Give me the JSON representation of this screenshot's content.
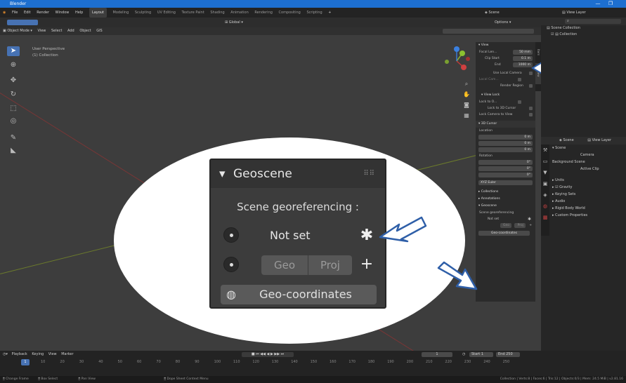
{
  "titlebar": {
    "title": "Blender"
  },
  "menubar": {
    "items": [
      "File",
      "Edit",
      "Render",
      "Window",
      "Help"
    ],
    "workspaces": [
      "Layout",
      "Modeling",
      "Sculpting",
      "UV Editing",
      "Texture Paint",
      "Shading",
      "Animation",
      "Rendering",
      "Compositing",
      "Scripting"
    ],
    "scene_label": "Scene",
    "view_layer_label": "View Layer"
  },
  "viewport": {
    "transform_orientation": "Global",
    "options_label": "Options",
    "mode_label": "Object Mode",
    "header_menus": [
      "View",
      "Select",
      "Add",
      "Object",
      "GIS"
    ],
    "perspective_label": "User Perspective",
    "collection_label": "(1) Collection"
  },
  "npanel": {
    "view_header": "View",
    "focal_length_label": "Focal Len...",
    "focal_length_value": "50 mm",
    "clip_start_label": "Clip Start",
    "clip_start_value": "0.1 m",
    "clip_end_label": "End",
    "clip_end_value": "1000 m",
    "use_local_camera": "Use Local Camera",
    "local_camera": "Local Cam...",
    "render_region": "Render Region",
    "view_lock_header": "View Lock",
    "lock_to_object": "Lock to O...",
    "lock_to_3d_cursor": "Lock to 3D Cursor",
    "lock_camera_to_view": "Lock Camera to View",
    "cursor_header": "3D Cursor",
    "location_label": "Location",
    "loc_x": "0 m",
    "loc_y": "0 m",
    "loc_z": "0 m",
    "rotation_label": "Rotation",
    "rot_x": "0°",
    "rot_y": "0°",
    "rot_z": "0°",
    "rotation_mode": "XYZ Euler",
    "collections_header": "Collections",
    "annotations_header": "Annotations",
    "geoscene_header": "Geoscene",
    "scene_georef_small": "Scene georeferencing",
    "not_set_small": "Not set",
    "geo_small": "Geo",
    "proj_small": "Proj",
    "geocoords_small": "Geo-coordinates",
    "tabs": [
      "Item",
      "Tool",
      "View"
    ]
  },
  "outliner": {
    "scene_collection": "Scene Collection",
    "collection": "Collection"
  },
  "properties": {
    "scene_tab": "Scene",
    "view_layer_tab": "View Layer",
    "scene_header": "Scene",
    "camera_label": "Camera",
    "background_scene_label": "Background Scene",
    "active_clip_label": "Active Clip",
    "sections": [
      "Units",
      "Gravity",
      "Keying Sets",
      "Audio",
      "Rigid Body World",
      "Custom Properties"
    ]
  },
  "geoscene_popup": {
    "title": "Geoscene",
    "subtitle": "Scene georeferencing :",
    "not_set": "Not set",
    "geo_button": "Geo",
    "proj_button": "Proj",
    "add_button": "+",
    "geocoords_button": "Geo-coordinates"
  },
  "timeline": {
    "menus": [
      "Playback",
      "Keying",
      "View",
      "Marker"
    ],
    "current_frame": "1",
    "start_label": "Start",
    "start_value": "1",
    "end_label": "End",
    "end_value": "250",
    "ticks": [
      "10",
      "20",
      "30",
      "40",
      "50",
      "60",
      "70",
      "80",
      "90",
      "100",
      "110",
      "120",
      "130",
      "140",
      "150",
      "160",
      "170",
      "180",
      "190",
      "200",
      "210",
      "220",
      "230",
      "240",
      "250"
    ],
    "current_tick": "1"
  },
  "statusbar": {
    "left_items": [
      "Change Frame",
      "Box Select",
      "Pan View",
      "Dope Sheet Context Menu"
    ],
    "right_text": "Collection | Verts:8 | Faces:6 | Tris:12 | Objects:0/3 | Mem: 24.5 MiB | v2.81.16"
  },
  "colors": {
    "accent": "#4772b3",
    "titlebar": "#1d6fd0",
    "axis_red": "#8a3a3a",
    "axis_green": "#7a8a30",
    "arrow": "#2f5fa8"
  }
}
